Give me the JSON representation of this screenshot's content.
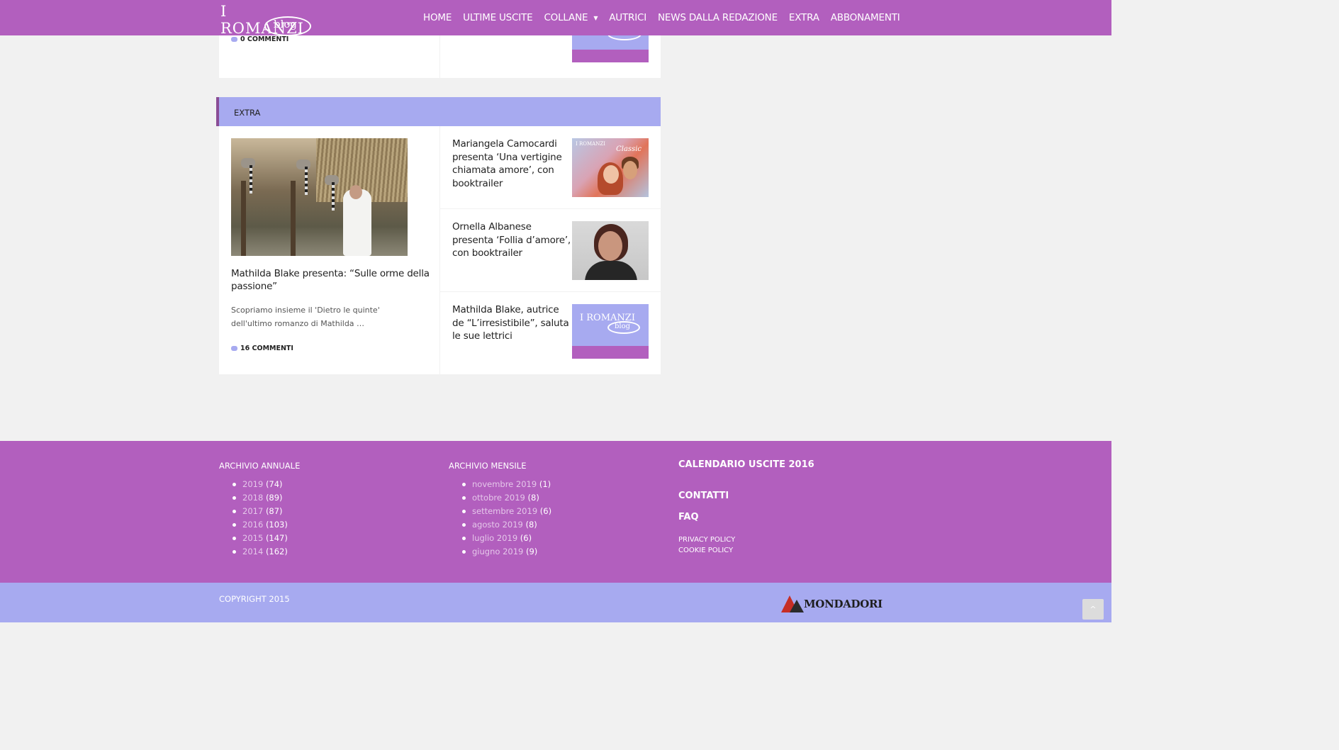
{
  "header": {
    "logo_top": "I ROMANZI",
    "logo_bottom": "blog",
    "nav": [
      {
        "label": "HOME"
      },
      {
        "label": "ULTIME USCITE"
      },
      {
        "label": "COLLANE",
        "has_dropdown": true
      },
      {
        "label": "AUTRICI"
      },
      {
        "label": "NEWS DALLA REDAZIONE"
      },
      {
        "label": "EXTRA"
      },
      {
        "label": "ABBONAMENTI"
      }
    ]
  },
  "prev_section": {
    "comments": "0 COMMENTI"
  },
  "extra_section": {
    "title": "EXTRA",
    "main": {
      "title": "Mathilda Blake presenta: “Sulle orme della passione”",
      "excerpt": "Scopriamo insieme il 'Dietro le quinte' dell'ultimo romanzo di Mathilda …",
      "comments": "16 COMMENTI"
    },
    "side": [
      {
        "title": "Mariangela Camocardi presenta ‘Una vertigine chiamata amore’, con booktrailer",
        "thumb_label": "Classic",
        "thumb_brand": "I ROMANZI"
      },
      {
        "title": "Ornella Albanese presenta ‘Follia d’amore’, con booktrailer"
      },
      {
        "title": "Mathilda Blake, autrice de “L’irresistibile”, saluta le sue lettrici",
        "thumb_brand": "I ROMANZI",
        "thumb_blog": "blog"
      }
    ]
  },
  "footer": {
    "annual_title": "ARCHIVIO ANNUALE",
    "annual": [
      {
        "label": "2019",
        "count": "(74)"
      },
      {
        "label": "2018",
        "count": "(89)"
      },
      {
        "label": "2017",
        "count": "(87)"
      },
      {
        "label": "2016",
        "count": "(103)"
      },
      {
        "label": "2015",
        "count": "(147)"
      },
      {
        "label": "2014",
        "count": "(162)"
      }
    ],
    "monthly_title": "ARCHIVIO MENSILE",
    "monthly": [
      {
        "label": "novembre 2019",
        "count": "(1)"
      },
      {
        "label": "ottobre 2019",
        "count": "(8)"
      },
      {
        "label": "settembre 2019",
        "count": "(6)"
      },
      {
        "label": "agosto 2019",
        "count": "(8)"
      },
      {
        "label": "luglio 2019",
        "count": "(6)"
      },
      {
        "label": "giugno 2019",
        "count": "(9)"
      }
    ],
    "calendar": "CALENDARIO USCITE 2016",
    "contacts": "CONTATTI",
    "faq": "FAQ",
    "privacy": "PRIVACY POLICY",
    "cookie": "COOKIE POLICY",
    "copyright": "COPYRIGHT 2015",
    "brand": "MONDADORI",
    "to_top": "^"
  },
  "colors": {
    "primary": "#b25fbe",
    "secondary": "#a7aaf0",
    "accent_border": "#8a4d96"
  }
}
